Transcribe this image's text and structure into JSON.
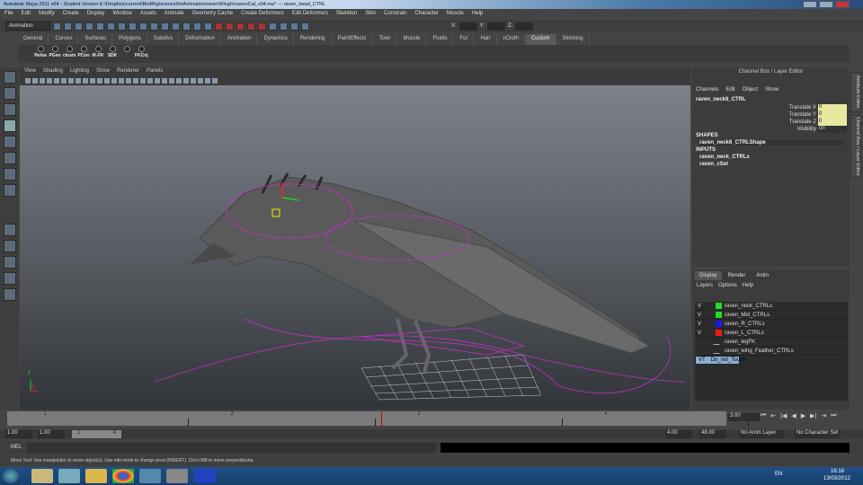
{
  "title": "Autodesk Maya 2011 x64 - Student Version  E:\\Dropbox\\current\\BirdRig\\scenes\\forAnimation\\ravenWingIn\\ravenCal_v04.ma*   ---   raven_head_CTRL",
  "menu": [
    "File",
    "Edit",
    "Modify",
    "Create",
    "Display",
    "Window",
    "Assets",
    "Animate",
    "Geometry Cache",
    "Create Deformers",
    "Edit Deformers",
    "Skeleton",
    "Skin",
    "Constrain",
    "Character",
    "Muscle",
    "Help"
  ],
  "status": {
    "mode": "Animation",
    "x_label": "X:",
    "y_label": "Y:",
    "z_label": "Z:"
  },
  "shelf_tabs": [
    "General",
    "Curves",
    "Surfaces",
    "Polygons",
    "Subdivs",
    "Deformation",
    "Animation",
    "Dynamics",
    "Rendering",
    "PaintEffects",
    "Toon",
    "Muscle",
    "Fluids",
    "Fur",
    "Hair",
    "nCloth",
    "Custom",
    "Skinning"
  ],
  "shelf_active": "Custom",
  "shelf_buttons": [
    "Reloa",
    "PGeo",
    "clusts",
    "PCon",
    "IK-FK",
    "SDK",
    "",
    "FKCnj"
  ],
  "viewport_menu": [
    "View",
    "Shading",
    "Lighting",
    "Show",
    "Renderer",
    "Panels"
  ],
  "axis": {
    "x": "x",
    "y": "y"
  },
  "channel_box": {
    "title": "Channel Box / Layer Editor",
    "menu": [
      "Channels",
      "Edit",
      "Object",
      "Show"
    ],
    "object": "raven_neck6_CTRL",
    "attrs": [
      {
        "name": "Translate X",
        "value": "0"
      },
      {
        "name": "Translate Y",
        "value": "0"
      },
      {
        "name": "Translate Z",
        "value": "0"
      },
      {
        "name": "Visibility",
        "value": "on"
      }
    ],
    "shapes_label": "SHAPES",
    "shape": "raven_neck6_CTRLShape",
    "inputs_label": "INPUTS",
    "inputs": [
      "raven_neck_CTRLs",
      "raven_cSet"
    ]
  },
  "side_tabs": [
    "Attribute Editor",
    "Channel Box / Layer Editor"
  ],
  "layer_editor": {
    "tabs": [
      "Display",
      "Render",
      "Anim"
    ],
    "menu": [
      "Layers",
      "Options",
      "Help"
    ],
    "layers": [
      {
        "v": "V",
        "t": "",
        "name": "raven_neck_CTRLs",
        "color": "#22dd22"
      },
      {
        "v": "V",
        "t": "",
        "name": "raven_Mid_CTRLs",
        "color": "#22dd22"
      },
      {
        "v": "V",
        "t": "",
        "name": "raven_R_CTRLs",
        "color": "#1a1aee"
      },
      {
        "v": "V",
        "t": "",
        "name": "raven_L_CTRLs",
        "color": "#ee1a1a"
      },
      {
        "v": "",
        "t": "",
        "name": "raven_legFK",
        "color": ""
      },
      {
        "v": "",
        "t": "",
        "name": "raven_wing_Feather_CTRLs",
        "color": ""
      },
      {
        "v": "V",
        "t": "T",
        "name": "Do_not_Touch",
        "color": "#111111"
      }
    ]
  },
  "timeline": {
    "ticks": [
      "1",
      "2",
      "3",
      "4"
    ],
    "current_time": "3.00",
    "current_frame": 3,
    "start": 1,
    "end": 4
  },
  "playback": [
    "⏮",
    "⇤",
    "|◀",
    "◀",
    "▶",
    "▶|",
    "⇥",
    "⏭"
  ],
  "range": {
    "start": "1.00",
    "start2": "1.00",
    "inner_start": "1",
    "inner_end": "4",
    "end": "4.00",
    "end2": "48.00",
    "anim_layer": "No Anim Layer",
    "char_set": "No Character Set"
  },
  "mel_label": "MEL",
  "help_line": "Move Tool: Use manipulator to move object(s). Use edit mode to change pivot (INSERT). Ctrl+LMB to move perpendicular.",
  "tray": {
    "lang": "EN",
    "time": "16:18",
    "date": "13/03/2012"
  }
}
